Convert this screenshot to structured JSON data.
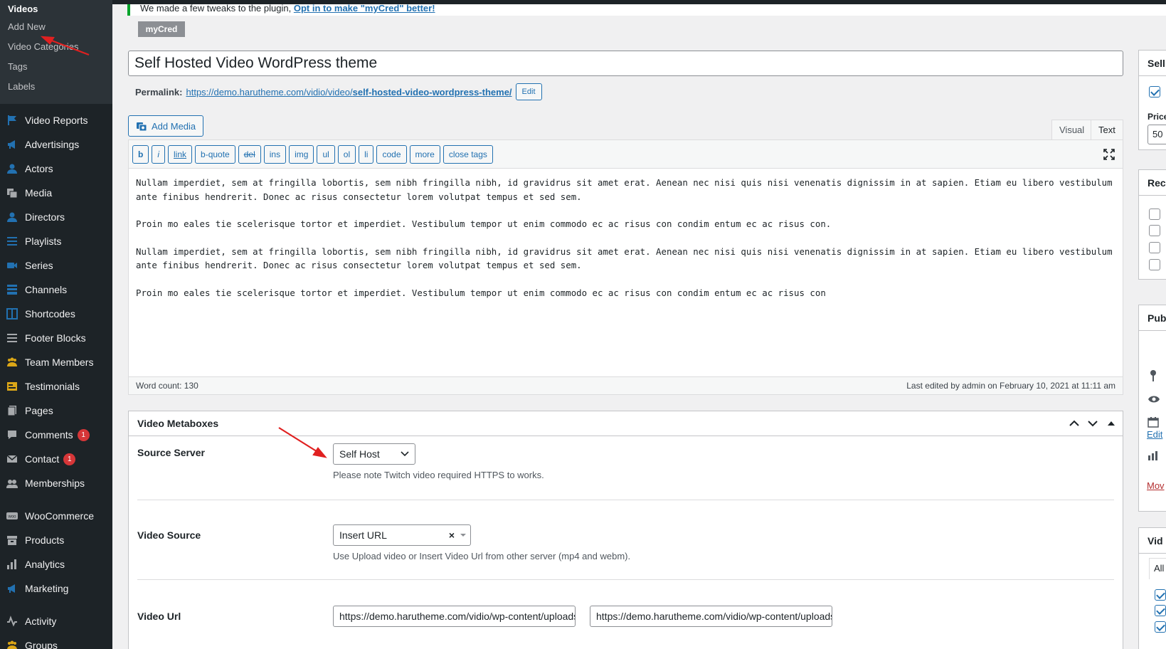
{
  "sidebar": {
    "section_title": "Videos",
    "sub_items": [
      "Add New",
      "Video Categories",
      "Tags",
      "Labels"
    ],
    "menu": [
      {
        "label": "Video Reports",
        "icon": "flag-icon"
      },
      {
        "label": "Advertisings",
        "icon": "megaphone-icon"
      },
      {
        "label": "Actors",
        "icon": "user-icon"
      },
      {
        "label": "Media",
        "icon": "media-icon"
      },
      {
        "label": "Directors",
        "icon": "user-icon"
      },
      {
        "label": "Playlists",
        "icon": "list-icon"
      },
      {
        "label": "Series",
        "icon": "video-camera-icon"
      },
      {
        "label": "Channels",
        "icon": "channels-icon"
      },
      {
        "label": "Shortcodes",
        "icon": "shortcodes-icon"
      },
      {
        "label": "Footer Blocks",
        "icon": "menu-icon"
      },
      {
        "label": "Team Members",
        "icon": "groups-icon"
      },
      {
        "label": "Testimonials",
        "icon": "testimonial-icon"
      },
      {
        "label": "Pages",
        "icon": "pages-icon"
      },
      {
        "label": "Comments",
        "icon": "comment-icon",
        "badge": "1"
      },
      {
        "label": "Contact",
        "icon": "mail-icon",
        "badge": "1"
      },
      {
        "label": "Memberships",
        "icon": "membership-icon"
      }
    ],
    "menu2": [
      {
        "label": "WooCommerce",
        "icon": "woo-icon"
      },
      {
        "label": "Products",
        "icon": "archive-icon"
      },
      {
        "label": "Analytics",
        "icon": "chart-icon"
      },
      {
        "label": "Marketing",
        "icon": "megaphone-icon"
      }
    ],
    "menu3": [
      {
        "label": "Activity",
        "icon": "activity-icon"
      },
      {
        "label": "Groups",
        "icon": "groups-icon"
      }
    ]
  },
  "notice": {
    "text": "We made a few tweaks to the plugin,",
    "link": "Opt in to make \"myCred\" better!"
  },
  "mycred_tab": "myCred",
  "post": {
    "title": "Self Hosted Video WordPress theme",
    "permalink_label": "Permalink:",
    "permalink_base": "https://demo.harutheme.com/vidio/video/",
    "permalink_slug": "self-hosted-video-wordpress-theme/",
    "edit_label": "Edit"
  },
  "editor": {
    "add_media": "Add Media",
    "tab_visual": "Visual",
    "tab_text": "Text",
    "quicktags": [
      "b",
      "i",
      "link",
      "b-quote",
      "del",
      "ins",
      "img",
      "ul",
      "ol",
      "li",
      "code",
      "more",
      "close tags"
    ],
    "paragraphs": [
      "Nullam imperdiet, sem at fringilla lobortis, sem nibh fringilla nibh, id gravidrus sit amet erat. Aenean nec nisi quis nisi venenatis dignissim in at sapien. Etiam eu libero vestibulum ante finibus hendrerit. Donec ac risus consectetur lorem volutpat tempus et sed sem.",
      "Proin mo eales tie scelerisque tortor et imperdiet. Vestibulum tempor ut enim commodo ec ac risus con condim entum ec ac risus con.",
      "Nullam imperdiet, sem at fringilla lobortis, sem nibh fringilla nibh, id gravidrus sit amet erat. Aenean nec nisi quis nisi venenatis dignissim in at sapien. Etiam eu libero vestibulum ante finibus hendrerit. Donec ac risus consectetur lorem volutpat tempus et sed sem.",
      "Proin mo eales tie scelerisque tortor et imperdiet. Vestibulum tempor ut enim commodo ec ac risus con condim entum ec ac risus con"
    ],
    "word_count": "Word count: 130",
    "last_edited": "Last edited by admin on February 10, 2021 at 11:11 am"
  },
  "metabox": {
    "title": "Video Metaboxes",
    "source_server_label": "Source Server",
    "source_server_value": "Self Host",
    "source_server_desc": "Please note Twitch video required HTTPS to works.",
    "video_source_label": "Video Source",
    "video_source_value": "Insert URL",
    "video_source_desc": "Use Upload video or Insert Video Url from other server (mp4 and webm).",
    "video_url_label": "Video Url",
    "video_url_1": "https://demo.harutheme.com/vidio/wp-content/uploads/",
    "video_url_2": "https://demo.harutheme.com/vidio/wp-content/uploads/"
  },
  "right": {
    "box1_title": "Sell",
    "box1_price_label": "Price",
    "box1_price_value": "50",
    "box2_title": "Rec",
    "box3_title": "Pub",
    "box3_edit": "Edit",
    "box3_move": "Mov",
    "box4_title": "Vid",
    "box4_all": "All"
  },
  "colors": {
    "sidebar_bg": "#1d2327",
    "accent": "#2271b1",
    "badge": "#d63638",
    "notice_border": "#00a32a",
    "arrow": "#e02020"
  }
}
